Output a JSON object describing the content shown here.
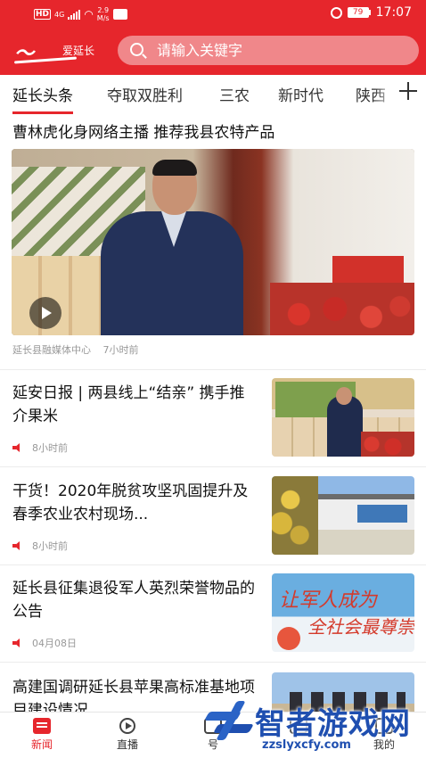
{
  "status_bar": {
    "network": "HD",
    "network_gen": "4G",
    "speed_value": "2.9",
    "speed_unit": "M/s",
    "battery": "79",
    "time": "17:07"
  },
  "header": {
    "logo_text": "爱延长",
    "logo_icon": "yanchang-logo",
    "search_placeholder": "请输入关键字",
    "search_icon": "search-icon"
  },
  "tabs": {
    "items": [
      {
        "label": "延长头条",
        "active": true
      },
      {
        "label": "夺取双胜利",
        "active": false
      },
      {
        "label": "三农",
        "active": false
      },
      {
        "label": "新时代",
        "active": false
      },
      {
        "label": "陕西",
        "active": false
      }
    ],
    "add_icon": "plus-icon"
  },
  "feature": {
    "title": "曹林虎化身网络主播 推荐我县农特产品",
    "source": "延长县融媒体中心",
    "time": "7小时前",
    "media": "video"
  },
  "articles": [
    {
      "title": "延安日报 | 两县线上“结亲” 携手推介果米",
      "time": "8小时前"
    },
    {
      "title": "干货！2020年脱贫攻坚巩固提升及春季农业农村现场...",
      "time": "8小时前"
    },
    {
      "title": "延长县征集退役军人英烈荣誉物品的公告",
      "time": "04月08日"
    },
    {
      "title": "高建国调研延长县苹果高标准基地项目建设情况",
      "time": ""
    }
  ],
  "thumb_texts": {
    "line1": "让军人成为",
    "line2": "全社会最尊崇"
  },
  "bottom_nav": [
    {
      "label": "新闻",
      "icon": "news-icon",
      "active": true
    },
    {
      "label": "直播",
      "icon": "live-icon",
      "active": false
    },
    {
      "label": "号",
      "icon": "account-icon",
      "active": false
    },
    {
      "label": "",
      "icon": "service-icon",
      "active": false
    },
    {
      "label": "我的",
      "icon": "profile-icon",
      "active": false
    }
  ],
  "watermark": {
    "brand": "智者游戏网",
    "url": "zzslyxcfy.com"
  },
  "colors": {
    "brand_red": "#e6262c",
    "search_bg": "#f0878a",
    "watermark_blue": "#1f4fb0"
  }
}
